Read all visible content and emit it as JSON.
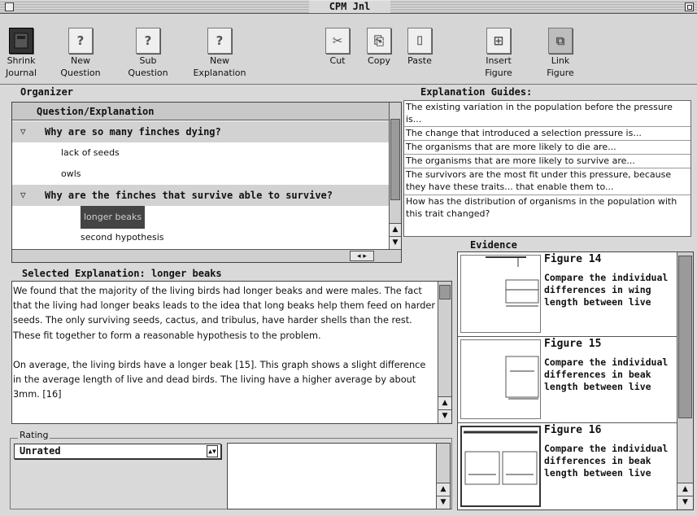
{
  "window": {
    "title": "CPM Jnl"
  },
  "toolbar": [
    {
      "label1": "Shrink",
      "label2": "Journal",
      "icon": "shrink-journal-icon",
      "glyph": ""
    },
    {
      "label1": "New",
      "label2": "Question",
      "icon": "question-mark-icon",
      "glyph": "?"
    },
    {
      "label1": "Sub",
      "label2": "Question",
      "icon": "sub-question-icon",
      "glyph": "?"
    },
    {
      "label1": "New",
      "label2": "Explanation",
      "icon": "new-explanation-icon",
      "glyph": "?"
    },
    {
      "label1": "Cut",
      "label2": "",
      "icon": "scissors-icon",
      "glyph": "✂"
    },
    {
      "label1": "Copy",
      "label2": "",
      "icon": "copy-icon",
      "glyph": "⎘"
    },
    {
      "label1": "Paste",
      "label2": "",
      "icon": "paste-icon",
      "glyph": "⌷"
    },
    {
      "label1": "Insert",
      "label2": "Figure",
      "icon": "insert-figure-icon",
      "glyph": "⊞"
    },
    {
      "label1": "Link",
      "label2": "Figure",
      "icon": "link-figure-icon",
      "glyph": "⧉"
    }
  ],
  "organizer": {
    "heading": "Organizer",
    "column_header": "Question/Explanation",
    "rows": [
      {
        "type": "question",
        "text": "Why are so many finches dying?"
      },
      {
        "type": "explanation",
        "text": "lack of seeds"
      },
      {
        "type": "explanation",
        "text": "owls"
      },
      {
        "type": "question",
        "text": "Why are the finches that survive able to survive?"
      },
      {
        "type": "explanation",
        "text": "longer beaks",
        "selected": true
      },
      {
        "type": "explanation",
        "text": "second hypothesis"
      }
    ]
  },
  "guides": {
    "heading": "Explanation Guides:",
    "items": [
      "The existing variation in the population before the pressure is...",
      "The change that introduced a selection pressure is...",
      "The organisms that are more likely to die are...",
      "The organisms that are more likely to survive are...",
      "The survivors are the most fit under this pressure, because they have these traits... that enable them to...",
      "How has the distribution of organisms in the population with this trait changed?"
    ]
  },
  "explanation": {
    "heading": "Selected Explanation: longer beaks",
    "paragraph1": "We found that the majority of the living birds had longer beaks and were males.  The fact that the living had longer beaks leads to the idea that long beaks help them feed on harder seeds.  The only surviving seeds, cactus, and tribulus, have harder shells than the rest.  These fit together to form a reasonable hypothesis to the problem.",
    "paragraph2": "On average, the living birds have a longer beak [15].  This graph shows a slight difference in the average length of live and dead birds.  The living have a higher average by about 3mm.  [16]"
  },
  "rating": {
    "label": "Rating",
    "value": "Unrated"
  },
  "evidence": {
    "heading": "Evidence",
    "figures": [
      {
        "title": "Figure 14",
        "desc": "Compare the individual differences in wing length between live"
      },
      {
        "title": "Figure 15",
        "desc": "Compare the individual differences in beak length between live"
      },
      {
        "title": "Figure 16",
        "desc": "Compare the individual differences in beak length between live"
      }
    ]
  }
}
